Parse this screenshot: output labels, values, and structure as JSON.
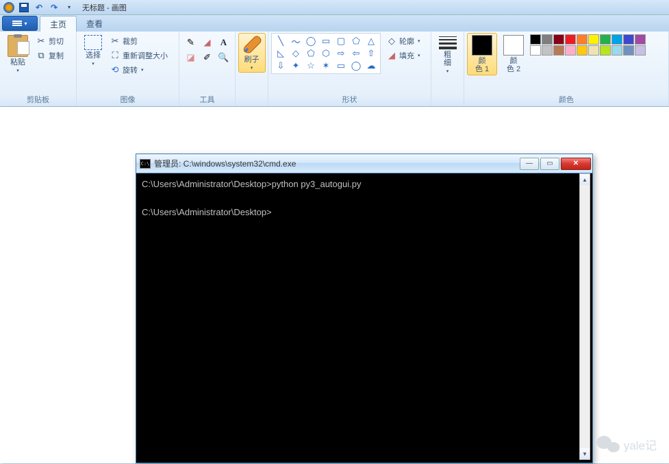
{
  "titlebar": {
    "title": "无标题 - 画图"
  },
  "tabs": {
    "file_drop": "▾",
    "home": "主页",
    "view": "查看"
  },
  "clipboard": {
    "paste": "粘贴",
    "cut": "剪切",
    "copy": "复制",
    "label": "剪贴板"
  },
  "image": {
    "select": "选择",
    "crop": "裁剪",
    "resize": "重新调整大小",
    "rotate": "旋转",
    "label": "图像"
  },
  "tools": {
    "label": "工具"
  },
  "brush": {
    "label": "刷子"
  },
  "shapes": {
    "outline": "轮廓",
    "fill": "填充",
    "label": "形状"
  },
  "stroke": {
    "label": "粗\n细"
  },
  "colors": {
    "c1": "颜\n色 1",
    "c2": "颜\n色 2",
    "label": "颜色",
    "c1_value": "#000000",
    "c2_value": "#ffffff",
    "palette": [
      "#000000",
      "#7f7f7f",
      "#880015",
      "#ed1c24",
      "#ff7f27",
      "#fff200",
      "#22b14c",
      "#00a2e8",
      "#3f48cc",
      "#a349a4",
      "#ffffff",
      "#c3c3c3",
      "#b97a57",
      "#ffaec9",
      "#ffc90e",
      "#efe4b0",
      "#b5e61d",
      "#99d9ea",
      "#7092be",
      "#c8bfe7"
    ]
  },
  "cmd": {
    "title": "管理员: C:\\windows\\system32\\cmd.exe",
    "line1": "C:\\Users\\Administrator\\Desktop>python py3_autogui.py",
    "line2": "C:\\Users\\Administrator\\Desktop>",
    "min": "—",
    "max": "▭",
    "close": "✕"
  },
  "watermark": "yale记"
}
